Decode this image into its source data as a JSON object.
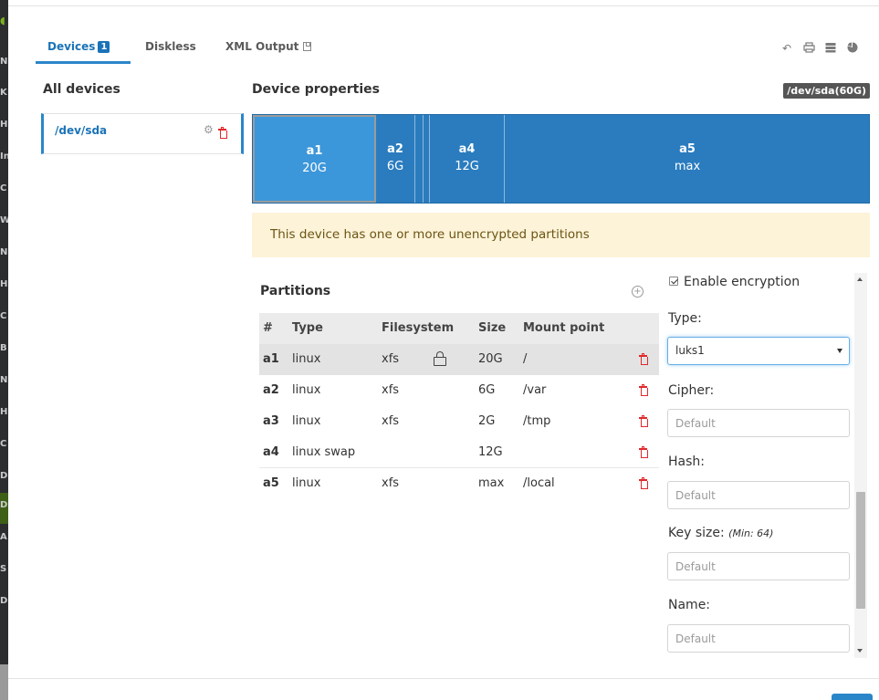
{
  "leftbar": {
    "letters": [
      "N",
      "K",
      "H",
      "In",
      "C",
      "W",
      "N",
      "H",
      "C",
      "B",
      "N",
      "H",
      "C",
      "D",
      "D",
      "A",
      "S",
      "D"
    ]
  },
  "tabs": [
    {
      "label": "Devices",
      "badge": "1",
      "active": true
    },
    {
      "label": "Diskless",
      "active": false
    },
    {
      "label": "XML Output",
      "active": false
    }
  ],
  "toolbar": {
    "icons": [
      "undo-icon",
      "print-icon",
      "storage-icon",
      "pie-chart-icon"
    ]
  },
  "all_devices": {
    "title": "All devices",
    "devices": [
      {
        "name": "/dev/sda"
      }
    ]
  },
  "device_properties": {
    "title": "Device properties",
    "device_tag": "/dev/sda(60G)",
    "segments": [
      {
        "label": "a1",
        "size": "20G",
        "selected": true
      },
      {
        "label": "a2",
        "size": "6G",
        "selected": false
      },
      {
        "label": "",
        "size": "",
        "selected": false
      },
      {
        "label": "",
        "size": "",
        "selected": false
      },
      {
        "label": "a4",
        "size": "12G",
        "selected": false
      },
      {
        "label": "a5",
        "size": "max",
        "selected": false
      }
    ],
    "warning": "This device has one or more unencrypted partitions"
  },
  "partitions": {
    "title": "Partitions",
    "columns": [
      "#",
      "Type",
      "Filesystem",
      "Size",
      "Mount point"
    ],
    "rows": [
      {
        "num": "a1",
        "type": "linux",
        "fs": "xfs",
        "locked": true,
        "size": "20G",
        "mount": "/",
        "selected": true
      },
      {
        "num": "a2",
        "type": "linux",
        "fs": "xfs",
        "locked": false,
        "size": "6G",
        "mount": "/var",
        "selected": false
      },
      {
        "num": "a3",
        "type": "linux",
        "fs": "xfs",
        "locked": false,
        "size": "2G",
        "mount": "/tmp",
        "selected": false
      },
      {
        "num": "a4",
        "type": "linux swap",
        "fs": "",
        "locked": false,
        "size": "12G",
        "mount": "",
        "selected": false
      },
      {
        "num": "a5",
        "type": "linux",
        "fs": "xfs",
        "locked": false,
        "size": "max",
        "mount": "/local",
        "selected": false
      }
    ]
  },
  "encryption": {
    "enable_label": "Enable encryption",
    "enabled": true,
    "type_label": "Type:",
    "type_value": "luks1",
    "cipher_label": "Cipher:",
    "cipher_placeholder": "Default",
    "hash_label": "Hash:",
    "hash_placeholder": "Default",
    "keysize_label": "Key size:",
    "keysize_hint": "(Min: 64)",
    "keysize_placeholder": "Default",
    "name_label": "Name:",
    "name_placeholder": "Default"
  }
}
